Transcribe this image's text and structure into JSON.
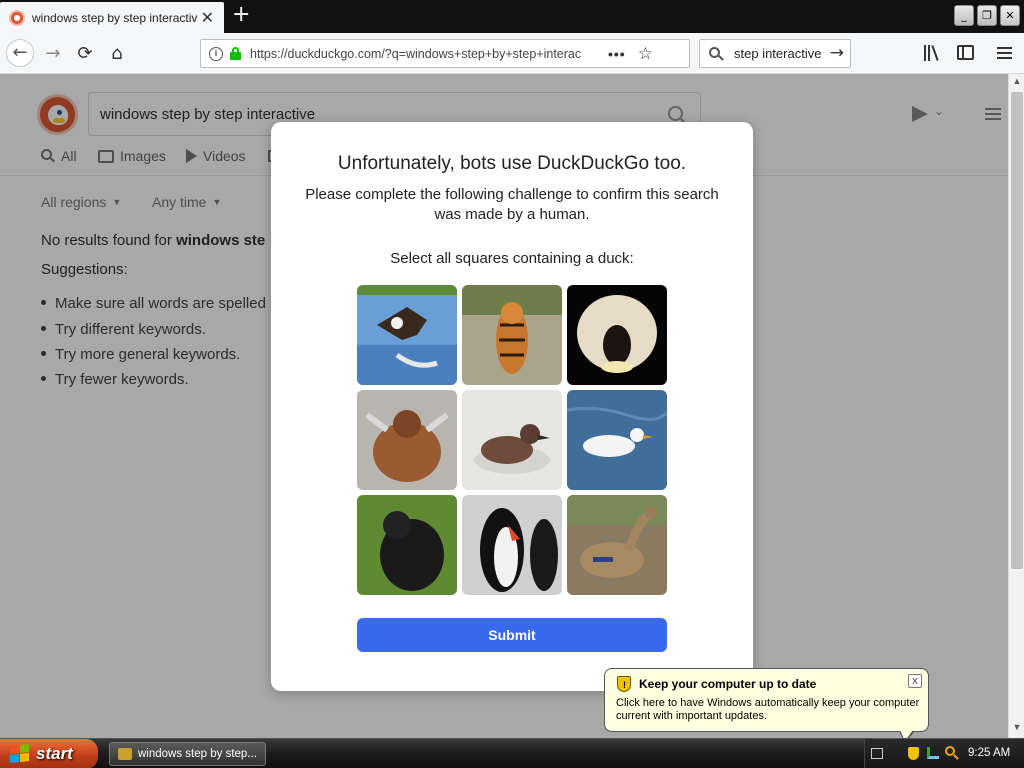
{
  "browser": {
    "tab_title": "windows step by step interactive a",
    "tab_close_glyph": "✕",
    "new_tab_glyph": "+",
    "url": "https://duckduckgo.com/?q=windows+step+by+step+interac",
    "url_more_glyph": "•••",
    "search_box_text": "step interactive",
    "window_controls": {
      "min": "_",
      "max": "❐",
      "close": "✕"
    },
    "icons": {
      "back": "back-arrow-icon",
      "forward": "forward-arrow-icon",
      "reload": "reload-icon",
      "home": "home-icon",
      "info": "info-icon",
      "lock": "lock-icon",
      "star": "star-icon",
      "library": "library-icon",
      "sidebar": "sidebar-icon",
      "menu": "hamburger-menu-icon"
    },
    "glyphs": {
      "back": "←",
      "forward": "→",
      "reload": "⟳",
      "home": "⌂",
      "star": "☆",
      "go": "→",
      "info": "i"
    }
  },
  "page": {
    "search_query": "windows step by step interactive",
    "tabs": [
      {
        "label": "All"
      },
      {
        "label": "Images"
      },
      {
        "label": "Videos"
      }
    ],
    "filters": [
      {
        "label": "All regions"
      },
      {
        "label": "Any time"
      }
    ],
    "filter_caret": "▼",
    "no_results_prefix": "No results found for ",
    "no_results_query": "windows ste",
    "suggestions_label": "Suggestions:",
    "suggestions": [
      "Make sure all words are spelled",
      "Try different keywords.",
      "Try more general keywords.",
      "Try fewer keywords."
    ]
  },
  "modal": {
    "title": "Unfortunately, bots use DuckDuckGo too.",
    "subtitle": "Please complete the following challenge to confirm this search was made by a human.",
    "prompt": "Select all squares containing a duck:",
    "tiles": [
      {
        "subject": "eagle-catching-fish"
      },
      {
        "subject": "tiger"
      },
      {
        "subject": "monkey-face"
      },
      {
        "subject": "orangutan"
      },
      {
        "subject": "brown-duck"
      },
      {
        "subject": "white-duck-swimming"
      },
      {
        "subject": "gorilla"
      },
      {
        "subject": "penguins"
      },
      {
        "subject": "mallard-duck"
      }
    ],
    "submit_label": "Submit",
    "submit_color": "#3969ef"
  },
  "balloon": {
    "title": "Keep your computer up to date",
    "text": "Click here to have Windows automatically keep your computer current with important updates.",
    "close_glyph": "x",
    "shield_glyph": "!"
  },
  "taskbar": {
    "start_label": "start",
    "task_label": "windows step by step...",
    "clock": "9:25 AM"
  },
  "scrollbar": {
    "up": "▲",
    "down": "▼"
  }
}
